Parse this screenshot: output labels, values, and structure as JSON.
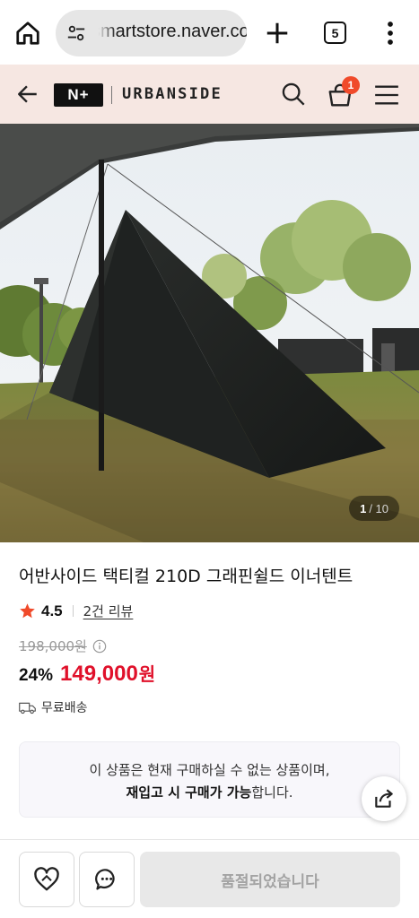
{
  "browser": {
    "url": "smartstore.naver.com",
    "tab_count": "5"
  },
  "store_header": {
    "logo_text": "N+",
    "brand": "URBANSIDE",
    "cart_badge": "1"
  },
  "hero": {
    "page_current": "1",
    "page_total": "/ 10"
  },
  "product": {
    "title": "어반사이드 택티컬 210D 그래핀쉴드 이너텐트",
    "rating": "4.5",
    "reviews": "2건 리뷰",
    "original_price": "198,000원",
    "discount": "24%",
    "price": "149,000",
    "currency": "원",
    "shipping": "무료배송"
  },
  "notice": {
    "line1": "이 상품은 현재 구매하실 수 없는 상품이며,",
    "line2_bold": "재입고 시 구매가 가능",
    "line2_rest": "합니다."
  },
  "bottom_bar": {
    "soldout_label": "품절되었습니다"
  },
  "colors": {
    "header_bg": "#f6e7e2",
    "price_red": "#e0102a",
    "badge": "#f04a2a"
  },
  "icons": [
    "home-icon",
    "site-settings-icon",
    "plus-icon",
    "tabs-icon",
    "kebab-menu-icon",
    "back-arrow-icon",
    "search-icon",
    "cart-icon",
    "hamburger-menu-icon",
    "star-icon",
    "info-icon",
    "truck-icon",
    "share-icon",
    "heart-icon",
    "chat-icon"
  ]
}
